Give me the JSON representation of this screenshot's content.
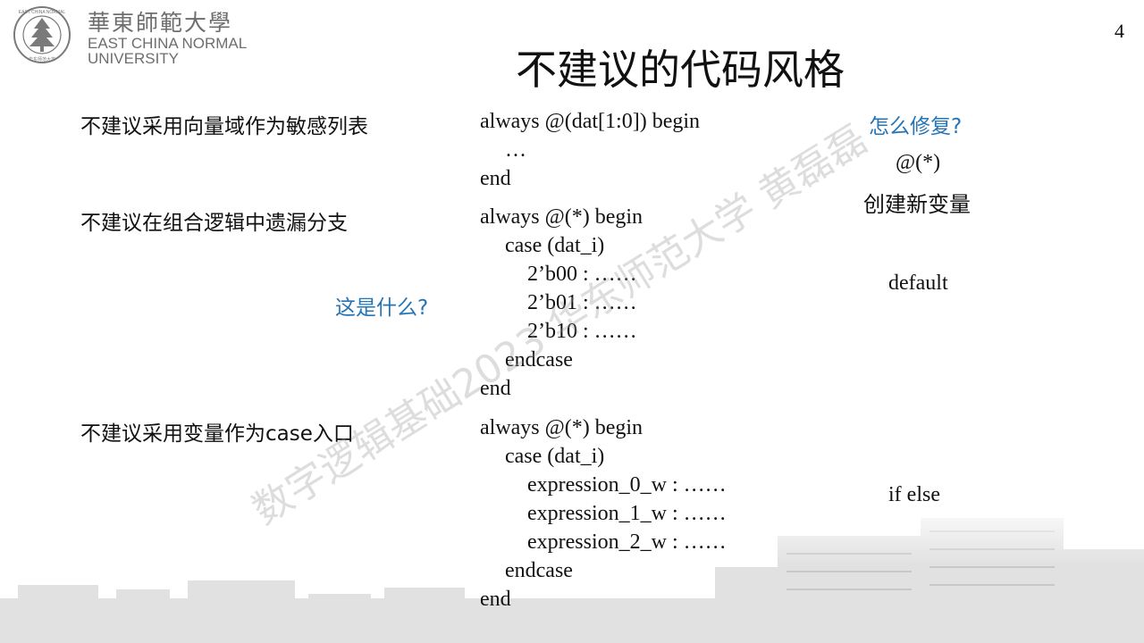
{
  "header": {
    "university_cn": "華東師範大學",
    "university_en_line1": "EAST CHINA NORMAL",
    "university_en_line2": "UNIVERSITY",
    "seal_text": "EAST CHINA NORMAL UNIVERSITY 华东师范大学",
    "page_number": "4"
  },
  "slide": {
    "title": "不建议的代码风格",
    "watermark": "数字逻辑基础2023 华东师范大学 黄磊磊",
    "rows": [
      {
        "category": "不建议采用向量域作为敏感列表",
        "code": [
          "always @(dat[1:0]) begin",
          "…",
          "end"
        ],
        "question": "怎么修复?",
        "fix": [
          "@(*)",
          "创建新变量"
        ]
      },
      {
        "category": "不建议在组合逻辑中遗漏分支",
        "code": [
          "always @(*) begin",
          "case (dat_i)",
          "2’b00 :    ……",
          "2’b01 :    ……",
          "2’b10 :    ……",
          "endcase",
          "end"
        ],
        "question": "这是什么?",
        "fix": [
          "default"
        ]
      },
      {
        "category": "不建议采用变量作为case入口",
        "code": [
          "always @(*) begin",
          "case (dat_i)",
          "expression_0_w :    ……",
          "expression_1_w :    ……",
          "expression_2_w :    ……",
          "endcase",
          "end"
        ],
        "fix": [
          "if else"
        ]
      }
    ]
  },
  "colors": {
    "accent_blue": "#2474b6",
    "logo_gray": "#6e6e6e"
  }
}
